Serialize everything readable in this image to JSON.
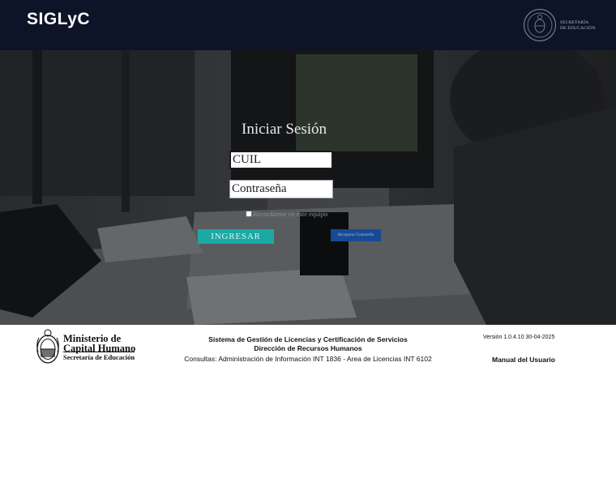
{
  "header": {
    "brand": "SIGLyC",
    "seal_caption_line1": "SECRETARÍA",
    "seal_caption_line2": "DE EDUCACIÓN"
  },
  "login": {
    "title": "Iniciar Sesión",
    "cuil_placeholder": "CUIL",
    "password_placeholder": "Contraseña",
    "remember_label": "Recordarme en este equipo",
    "login_button": "INGRESAR",
    "recover_button": "Recuperar Contraseña"
  },
  "footer": {
    "ministry_line1": "Ministerio de",
    "ministry_line2": "Capital Humano",
    "ministry_sub": "Secretaría de Educación",
    "system_name": "Sistema de Gestión de Licencias y Certificación de Servicios",
    "department": "Dirección de Recursos Humanos",
    "contact": "Consultas: Administración de Información INT 1836 - Area de Licencias INT 6102",
    "version": "Versión 1.0.4.10 30-04-2025",
    "manual_link": "Manual del Usuario"
  },
  "colors": {
    "header_bg": "#0d1428",
    "login_button": "#1aa9a3",
    "recover_button": "#174a96"
  }
}
